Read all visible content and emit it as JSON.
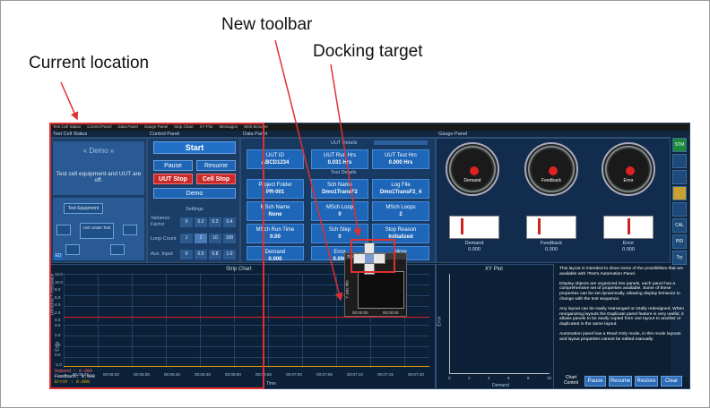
{
  "annotations": {
    "current_location": "Current location",
    "new_toolbar": "New toolbar",
    "docking_target": "Docking target"
  },
  "menu": [
    "Test Cell Status",
    "Control Panel",
    "Data Panel",
    "Gauge Panel",
    "Strip Chart",
    "XY Plot",
    "Messages",
    "Web Browser"
  ],
  "panels": {
    "test_cell": "Test Cell Status",
    "control": "Control Panel",
    "data": "Data Panel",
    "gauge": "Gauge Panel"
  },
  "test_cell": {
    "demo": "« Demo »",
    "status": "Test cell equipment and UUT are off.",
    "equipment": "Test Equipment",
    "uut": "Unit Under Test",
    "ed": "ED"
  },
  "control": {
    "start": "Start",
    "pause": "Pause",
    "resume": "Resume",
    "uut_stop": "UUT Stop",
    "cell_stop": "Cell Stop",
    "mode": "Demo",
    "settings": "Settings",
    "variance": "Variance Factor",
    "loop": "Loop Count",
    "aux": "Aux. Input",
    "variance_vals": [
      "0",
      "0.2",
      "0.3",
      "0.4"
    ],
    "loop_vals": [
      "1",
      "2",
      "10",
      "100"
    ],
    "aux_vals": [
      "0",
      "0.5",
      "0.8",
      "1.0"
    ]
  },
  "data": {
    "uut_details": "UUT Details",
    "test_details": "Test Details",
    "tiles": [
      {
        "label": "UUT ID",
        "value": "ABCD1234"
      },
      {
        "label": "UUT Run Hrs",
        "value": "0.031 Hrs"
      },
      {
        "label": "UUT Test Hrs",
        "value": "0.000 Hrs"
      },
      {
        "label": "Project Folder",
        "value": "PR-001"
      },
      {
        "label": "Sch Name",
        "value": "Dmo1TransF2"
      },
      {
        "label": "Log File",
        "value": "Dmo1TransF2_4"
      },
      {
        "label": "MSch Name",
        "value": "None"
      },
      {
        "label": "MSch Loop",
        "value": "0"
      },
      {
        "label": "MSch Loops",
        "value": "2"
      },
      {
        "label": "MSch Run Time",
        "value": "0.00"
      },
      {
        "label": "Sch Step",
        "value": "0"
      },
      {
        "label": "Stop Reason",
        "value": "Initialized"
      },
      {
        "label": "Demand",
        "value": "0.000"
      },
      {
        "label": "Error",
        "value": "0.000"
      },
      {
        "label": "More",
        "value": ""
      }
    ]
  },
  "gauges": [
    {
      "label": "Demand"
    },
    {
      "label": "Feedback"
    },
    {
      "label": "Error"
    }
  ],
  "gauge_scale": [
    "0",
    "2",
    "4",
    "6",
    "8",
    "10",
    "12",
    "14",
    "16"
  ],
  "meters": [
    {
      "label": "Demand",
      "value": "0.000"
    },
    {
      "label": "Feedback",
      "value": "0.000"
    },
    {
      "label": "Error",
      "value": "0.000"
    }
  ],
  "side_tools": [
    "STM",
    "",
    "",
    "",
    "CAL",
    "PID",
    "Try"
  ],
  "strip_chart": {
    "title": "Strip Chart",
    "ylabel1": "Demand + Feedback",
    "ylabel2": "Error",
    "yticks1": [
      "12.0",
      "10.0",
      "8.0",
      "6.0",
      "4.0",
      "2.0",
      "0.0"
    ],
    "yticks2": [
      "3.0",
      "2.0",
      "1.0",
      "0.0",
      "-1.0"
    ],
    "xticks": [
      "00:06:25",
      "00:06:30",
      "00:06:35",
      "00:06:40",
      "00:06:45",
      "00:06:50",
      "00:06:55",
      "00:07:00",
      "00:07:05",
      "00:07:10",
      "00:07:15",
      "00:07:20"
    ],
    "xlabel": "Time",
    "legend": [
      "Demand : 0.000",
      "Feedback: 0.000",
      "Error : 0.000"
    ]
  },
  "xy_plot": {
    "title": "XY Plot",
    "xlabel": "Demand",
    "ylabel": "Error",
    "xticks": [
      "0",
      "2",
      "4",
      "6",
      "8",
      "10"
    ]
  },
  "floating": {
    "title": "Toolbar",
    "ylabel": "Y axis title",
    "t1": "00:00:00",
    "t2": "00:00:00"
  },
  "info": [
    "This layout is intended to show some of the possibilities that are available with iTest's Automation Panel.",
    "Display objects are organized into panels, each panel has a comprehensive set of properties available. Some of these properties can be set dynamically, allowing display behavior to change with the test sequence.",
    "Any layout can be easily rearranged or totally redesigned. When reorganizing layouts the Duplicate panel feature is very useful, it allows panels to be easily copied from one layout to another or duplicated in the same layout.",
    "Automation panel has a Read Only mode, in this mode layouts and layout properties cannot be edited manually."
  ],
  "chart_controls": {
    "label": "Chart Control",
    "pause": "Pause",
    "resume": "Resume",
    "restore": "Restore",
    "clear": "Clear"
  }
}
